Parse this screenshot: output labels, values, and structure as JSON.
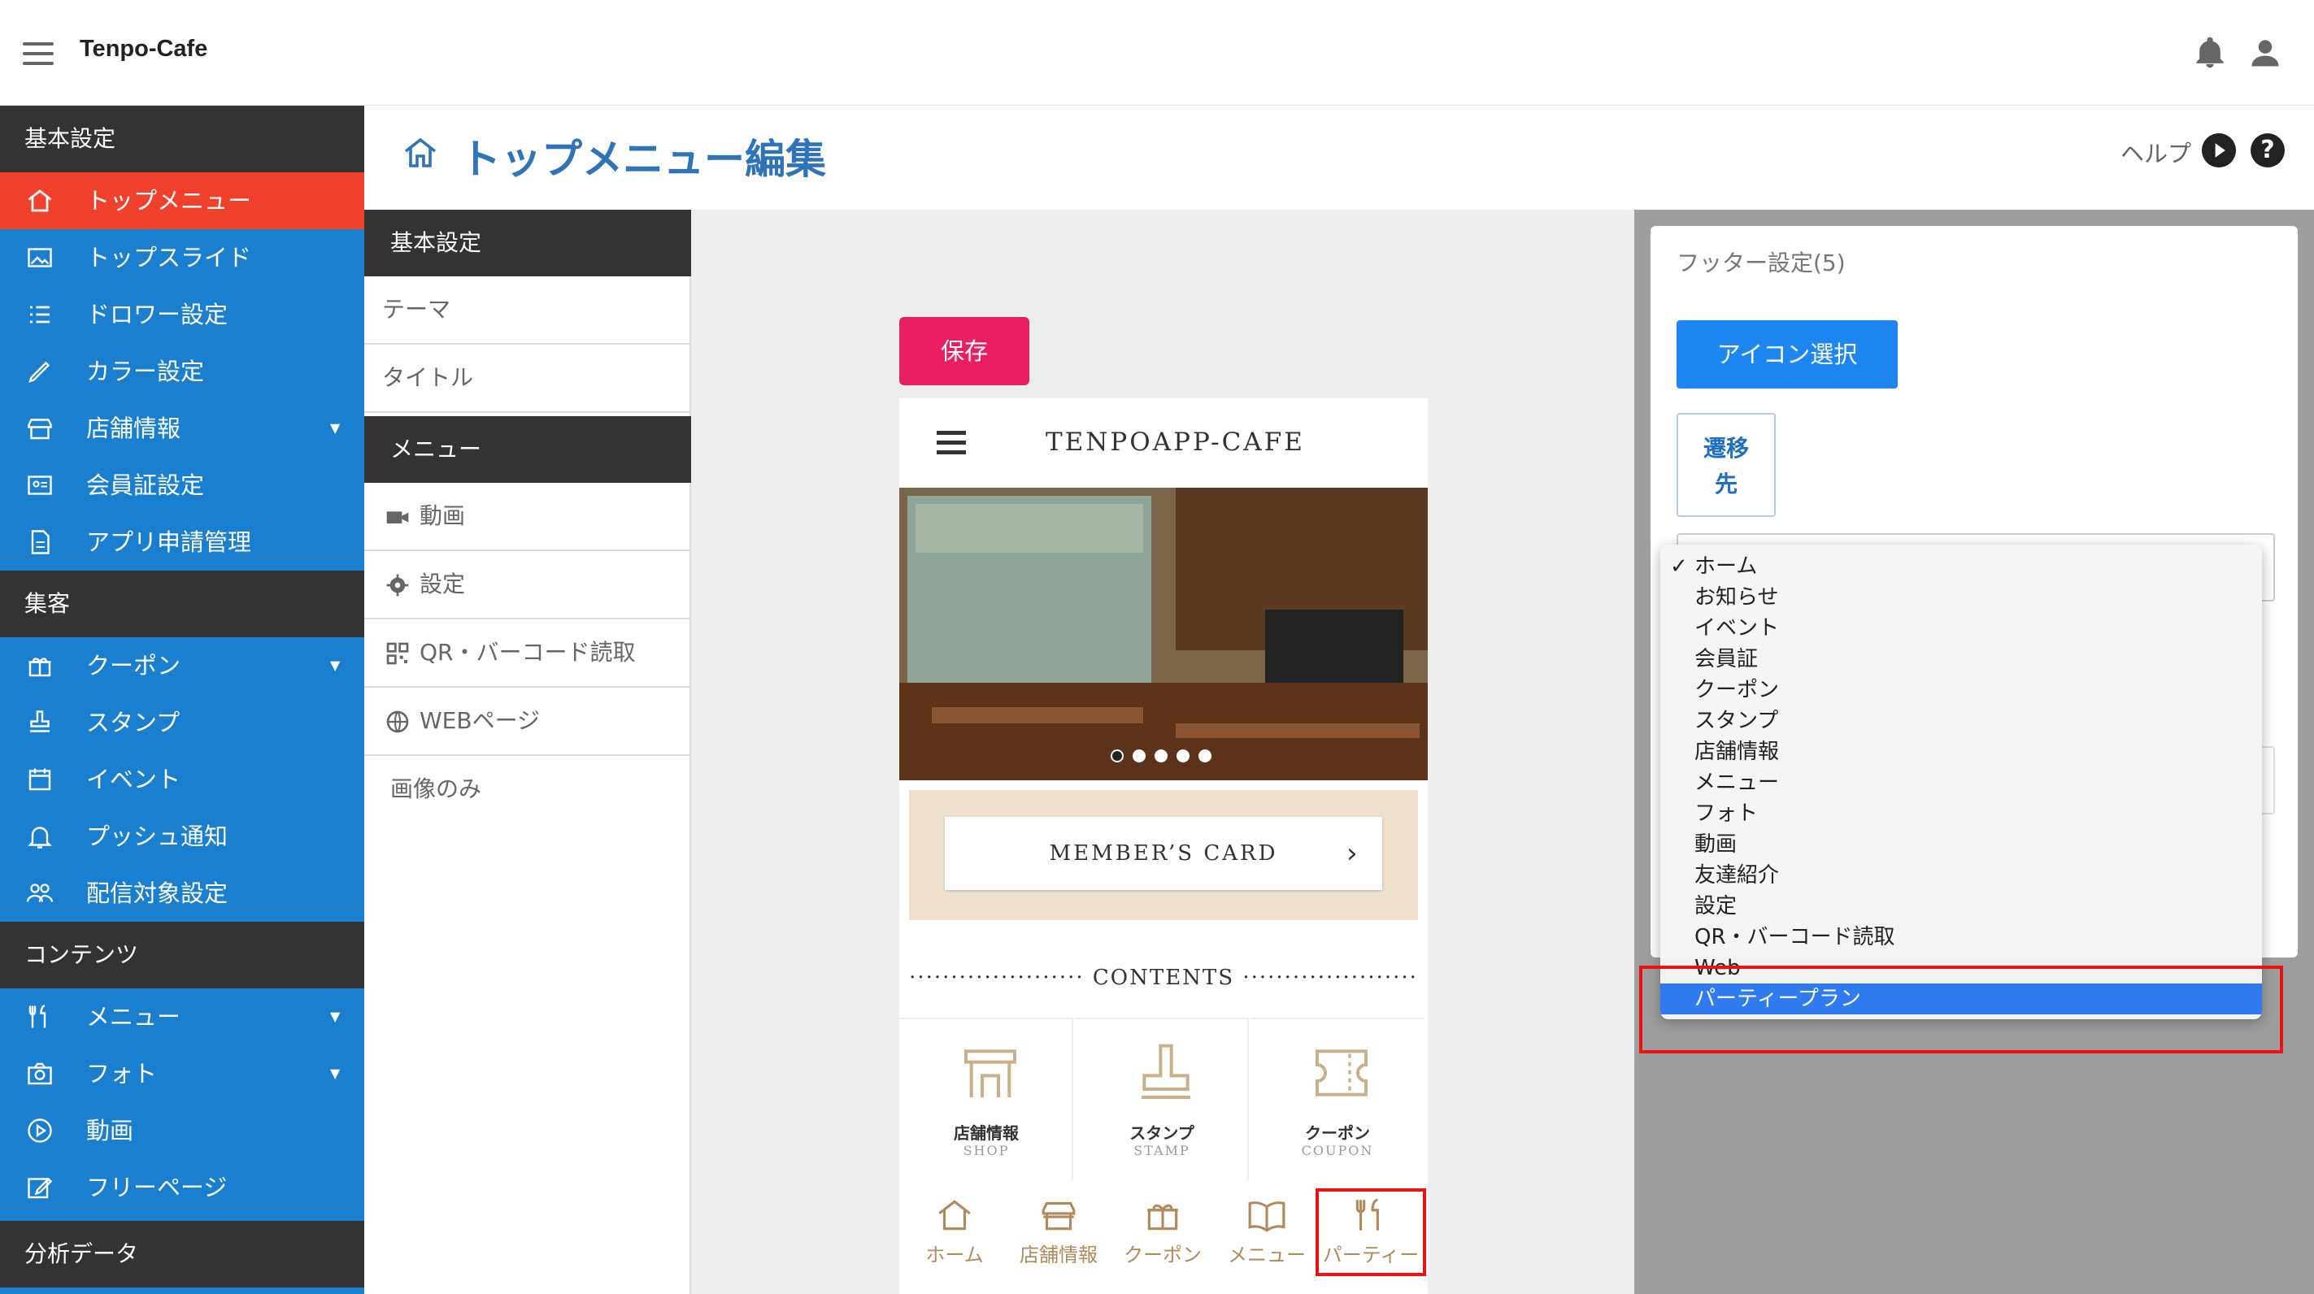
{
  "app": {
    "title": "Tenpo-Cafe"
  },
  "sidebar": {
    "sections": [
      {
        "label": "基本設定"
      },
      {
        "label": "集客"
      },
      {
        "label": "コンテンツ"
      },
      {
        "label": "分析データ"
      }
    ],
    "items": [
      {
        "label": "トップメニュー",
        "icon": "home-icon",
        "active": true
      },
      {
        "label": "トップスライド",
        "icon": "image-icon"
      },
      {
        "label": "ドロワー設定",
        "icon": "list-icon"
      },
      {
        "label": "カラー設定",
        "icon": "pencil-icon"
      },
      {
        "label": "店舗情報",
        "icon": "store-icon",
        "expandable": true
      },
      {
        "label": "会員証設定",
        "icon": "id-card-icon"
      },
      {
        "label": "アプリ申請管理",
        "icon": "document-icon"
      },
      {
        "label": "クーポン",
        "icon": "gift-icon",
        "expandable": true
      },
      {
        "label": "スタンプ",
        "icon": "stamp-icon"
      },
      {
        "label": "イベント",
        "icon": "calendar-icon"
      },
      {
        "label": "プッシュ通知",
        "icon": "bell-icon"
      },
      {
        "label": "配信対象設定",
        "icon": "people-icon"
      },
      {
        "label": "メニュー",
        "icon": "utensils-icon",
        "expandable": true
      },
      {
        "label": "フォト",
        "icon": "camera-icon",
        "expandable": true
      },
      {
        "label": "動画",
        "icon": "play-circle-icon"
      },
      {
        "label": "フリーページ",
        "icon": "edit-icon"
      }
    ]
  },
  "header": {
    "title": "トップメニュー編集",
    "help_label": "ヘルプ",
    "question_glyph": "?"
  },
  "menu_list": {
    "sections": [
      {
        "label": "基本設定"
      },
      {
        "label": "メニュー"
      }
    ],
    "items": [
      {
        "label": "テーマ"
      },
      {
        "label": "タイトル"
      },
      {
        "label": "動画",
        "icon": "video-icon"
      },
      {
        "label": "設定",
        "icon": "gear-icon"
      },
      {
        "label": "QR・バーコード読取",
        "icon": "qr-icon"
      },
      {
        "label": "WEBページ",
        "icon": "globe-icon"
      },
      {
        "label": "画像のみ"
      }
    ]
  },
  "preview": {
    "save_label": "保存",
    "phone_title": "TENPOAPP-CAFE",
    "member_card_label": "MEMBER’S CARD",
    "member_card_chevron": "›",
    "contents_label": "·····················  CONTENTS  ·····················",
    "tiles": [
      {
        "label": "店舗情報",
        "sub": "SHOP"
      },
      {
        "label": "スタンプ",
        "sub": "STAMP"
      },
      {
        "label": "クーポン",
        "sub": "COUPON"
      }
    ],
    "nav": [
      {
        "label": "ホーム"
      },
      {
        "label": "店舗情報"
      },
      {
        "label": "クーポン"
      },
      {
        "label": "メニュー"
      },
      {
        "label": "パーティー"
      }
    ]
  },
  "footer_panel": {
    "title": "フッター設定(5)",
    "icon_select_label": "アイコン選択",
    "destination_label_1": "遷移",
    "destination_label_2": "先",
    "dropdown": {
      "check_glyph": "✓",
      "options": [
        {
          "label": "ホーム",
          "checked": true
        },
        {
          "label": "お知らせ"
        },
        {
          "label": "イベント"
        },
        {
          "label": "会員証"
        },
        {
          "label": "クーポン"
        },
        {
          "label": "スタンプ"
        },
        {
          "label": "店舗情報"
        },
        {
          "label": "メニュー"
        },
        {
          "label": "フォト"
        },
        {
          "label": "動画"
        },
        {
          "label": "友達紹介"
        },
        {
          "label": "設定"
        },
        {
          "label": "QR・バーコード読取"
        },
        {
          "label": "Web"
        },
        {
          "label": "パーティープラン",
          "highlighted": true
        }
      ]
    }
  },
  "colors": {
    "sidebar_bg": "#1a7fce",
    "sidebar_active": "#f0412d",
    "header_dark": "#333333",
    "title_blue": "#2f73b9",
    "save_pink": "#e91e63",
    "primary_button": "#1e86f0",
    "highlight_red": "#ee1111",
    "dropdown_selected": "#2f7bef"
  }
}
